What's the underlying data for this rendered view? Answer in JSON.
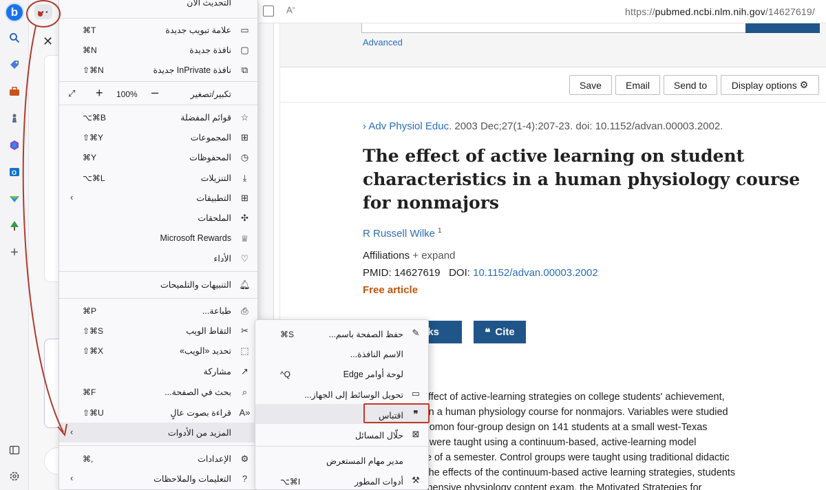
{
  "address_bar": {
    "url_prefix": "https://",
    "url_host": "pubmed.ncbi.nlm.nih.gov",
    "url_path": "/14627619/"
  },
  "page": {
    "advanced": "Advanced",
    "toolbar": {
      "save": "Save",
      "email": "Email",
      "send_to": "Send to",
      "display_options": "Display options"
    },
    "journal_name": "Adv Physiol Educ.",
    "journal_details": "2003 Dec;27(1-4):207-23. doi: 10.1152/advan.00003.2002.",
    "title": "The effect of active learning on student characteristics in a human physiology course for nonmajors",
    "author": "R Russell Wilke",
    "author_sup": "1",
    "affiliations_label": "Affiliations",
    "affiliations_expand": "+ expand",
    "pmid_label": "PMID: 14627619",
    "doi_label": "DOI:",
    "doi_value": "10.1152/advan.00003.2002",
    "free_article": "Free article",
    "links_button": "inks",
    "cite_button": "Cite",
    "abstract_lines": [
      "estigated the effect of active-learning strategies on college students' achievement,",
      "d self-efficacy in a human physiology course for nonmajors. Variables were studied",
      "perimental, Solomon four-group design on 141 students at a small west-Texas",
      "atment groups were taught using a continuum-based, active-learning model",
      "over the course of a semester. Control groups were taught using traditional didactic",
      "ds. To assess the effects of the continuum-based active learning strategies, students",
      "ered a comprehensive physiology content exam, the Motivated Strategies for"
    ]
  },
  "menu": {
    "top_item": "التحديث الآن",
    "items": [
      {
        "label": "علامة تبويب جديدة",
        "shortcut": "⌘T",
        "icon": "new-tab-icon"
      },
      {
        "label": "نافذة جديدة",
        "shortcut": "⌘N",
        "icon": "new-window-icon"
      },
      {
        "label": "نافذة InPrivate جديدة",
        "shortcut": "⇧⌘N",
        "icon": "inprivate-icon"
      },
      {
        "label": "قوائم المفضلة",
        "shortcut": "⌥⌘B",
        "icon": "favorites-icon"
      },
      {
        "label": "المجموعات",
        "shortcut": "⇧⌘Y",
        "icon": "collections-icon"
      },
      {
        "label": "المحفوظات",
        "shortcut": "⌘Y",
        "icon": "history-icon"
      },
      {
        "label": "التنزيلات",
        "shortcut": "⌥⌘L",
        "icon": "downloads-icon"
      },
      {
        "label": "التطبيقات",
        "shortcut": "",
        "icon": "apps-icon"
      },
      {
        "label": "الملحقات",
        "shortcut": "",
        "icon": "extensions-icon"
      },
      {
        "label": "Microsoft Rewards",
        "shortcut": "",
        "icon": "rewards-icon"
      },
      {
        "label": "الأداء",
        "shortcut": "",
        "icon": "performance-icon"
      },
      {
        "label": "التنبيهات والتلميحات",
        "shortcut": "",
        "icon": "bell-icon"
      },
      {
        "label": "طباعة...",
        "shortcut": "⌘P",
        "icon": "print-icon"
      },
      {
        "label": "التقاط الويب",
        "shortcut": "⇧⌘S",
        "icon": "web-capture-icon"
      },
      {
        "label": "تحديد «الويب»",
        "shortcut": "⇧⌘X",
        "icon": "web-select-icon"
      },
      {
        "label": "مشاركة",
        "shortcut": "",
        "icon": "share-icon"
      },
      {
        "label": "بحث في الصفحة...",
        "shortcut": "⌘F",
        "icon": "find-icon"
      },
      {
        "label": "قراءة بصوت عالٍ",
        "shortcut": "⇧⌘U",
        "icon": "read-aloud-icon"
      },
      {
        "label": "المزيد من الأدوات",
        "shortcut": "",
        "icon": "more-tools-icon"
      },
      {
        "label": "الإعدادات",
        "shortcut": "⌘,",
        "icon": "settings-icon"
      },
      {
        "label": "التعليمات والملاحظات",
        "shortcut": "",
        "icon": "help-icon"
      }
    ],
    "zoom": {
      "label": "تكبير/تصغير",
      "value": "100%"
    }
  },
  "submenu": {
    "items": [
      {
        "label": "حفظ الصفحة باسم...",
        "shortcut": "⌘S",
        "icon": "save-page-icon"
      },
      {
        "label": "الاسم النافذة...",
        "shortcut": "",
        "icon": ""
      },
      {
        "label": "لوحة أوامر Edge",
        "shortcut": "^Q",
        "icon": ""
      },
      {
        "label": "تحويل الوسائط إلى الجهاز...",
        "shortcut": "",
        "icon": "cast-icon"
      },
      {
        "label": "اقتباس",
        "shortcut": "",
        "icon": "quote-icon"
      },
      {
        "label": "حلّال المسائل",
        "shortcut": "",
        "icon": "math-solver-icon"
      },
      {
        "label": "مدير مهام المستعرض",
        "shortcut": "",
        "icon": ""
      },
      {
        "label": "أدوات المطور",
        "shortcut": "⌥⌘I",
        "icon": "dev-tools-icon"
      }
    ]
  },
  "colors": {
    "accent_blue": "#20558a",
    "link_blue": "#2a6ebb",
    "free_orange": "#c0550f",
    "annotation_red": "#b03a2e"
  }
}
